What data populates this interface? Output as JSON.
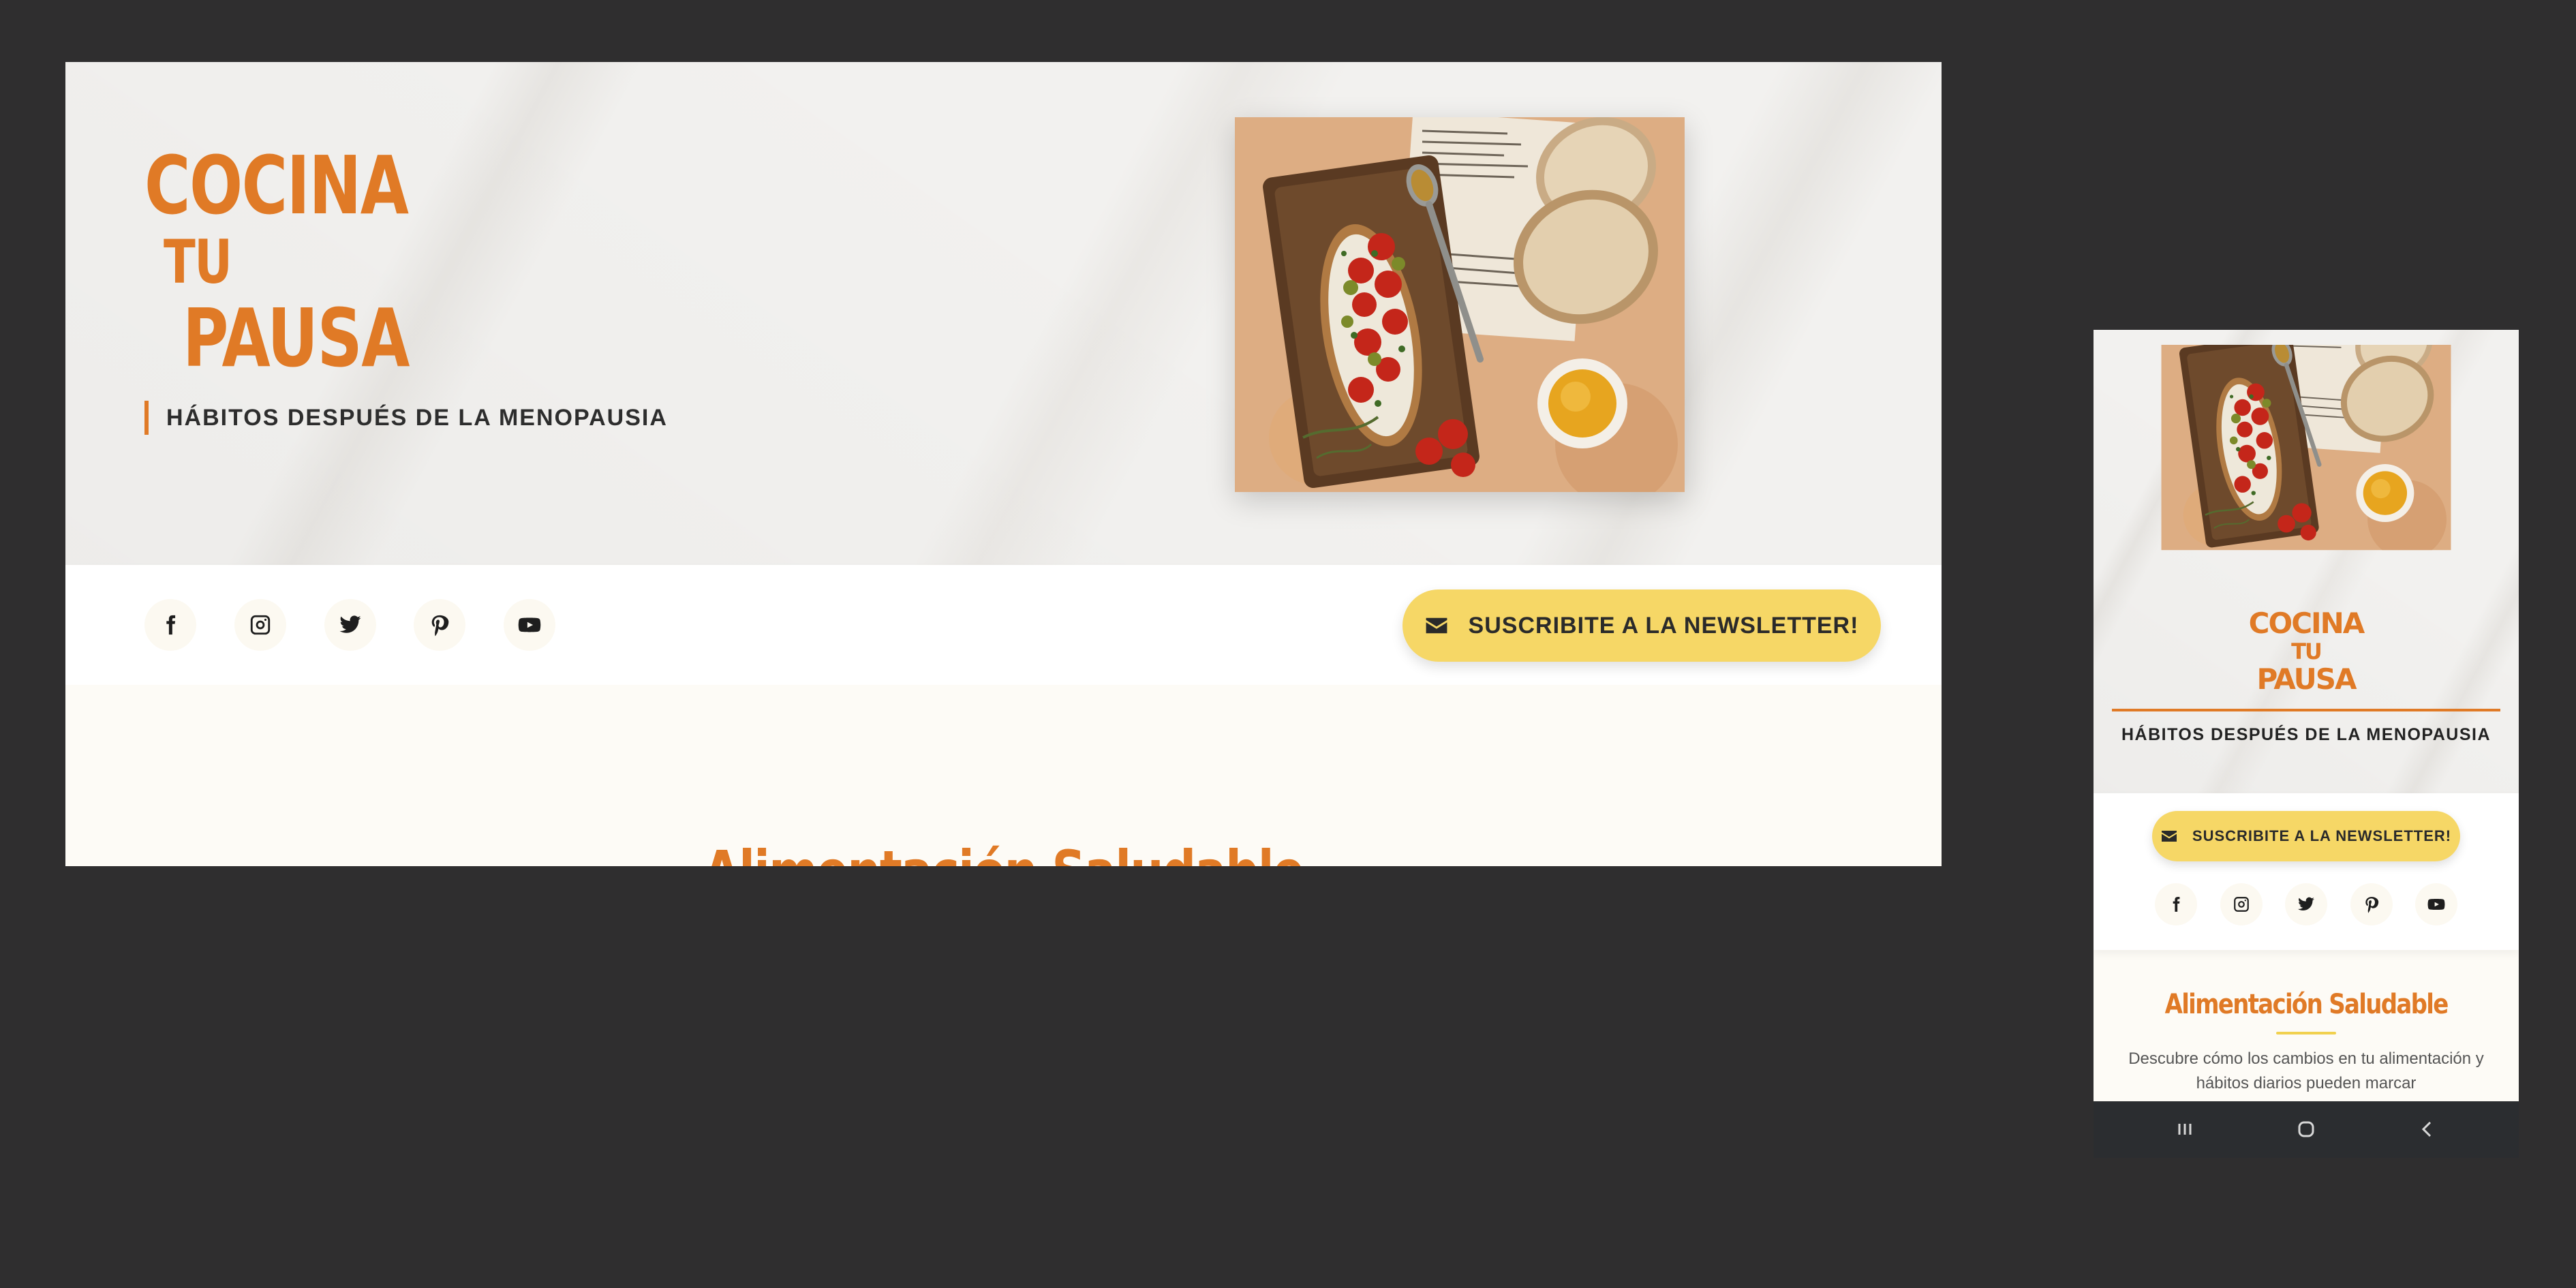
{
  "brand": {
    "title_line1": "COCINA",
    "title_line2": "TU",
    "title_line3": "PAUSA",
    "tagline": "HÁBITOS DESPUÉS DE LA MENOPAUSIA"
  },
  "hero_image": {
    "description_icon": "bruschetta-photo"
  },
  "social": [
    {
      "name": "facebook-icon"
    },
    {
      "name": "instagram-icon"
    },
    {
      "name": "twitter-icon"
    },
    {
      "name": "pinterest-icon"
    },
    {
      "name": "youtube-icon"
    }
  ],
  "newsletter": {
    "desktop_label": "SUSCRIBITE A LA NEWSLETTER!",
    "mobile_label": "SUSCRIBITE A LA NEWSLETTER!",
    "icon": "envelope-icon"
  },
  "section": {
    "title": "Alimentación Saludable",
    "description": "Descubre cómo los cambios en tu alimentación y hábitos diarios pueden marcar"
  },
  "android_nav": [
    "recents-icon",
    "home-icon",
    "back-icon"
  ],
  "colors": {
    "accent_orange": "#e07a26",
    "button_yellow": "#f6d766",
    "underline_yellow": "#f1d14f",
    "background_dark": "#2f2e2f",
    "section_cream": "#fdfbf6"
  }
}
